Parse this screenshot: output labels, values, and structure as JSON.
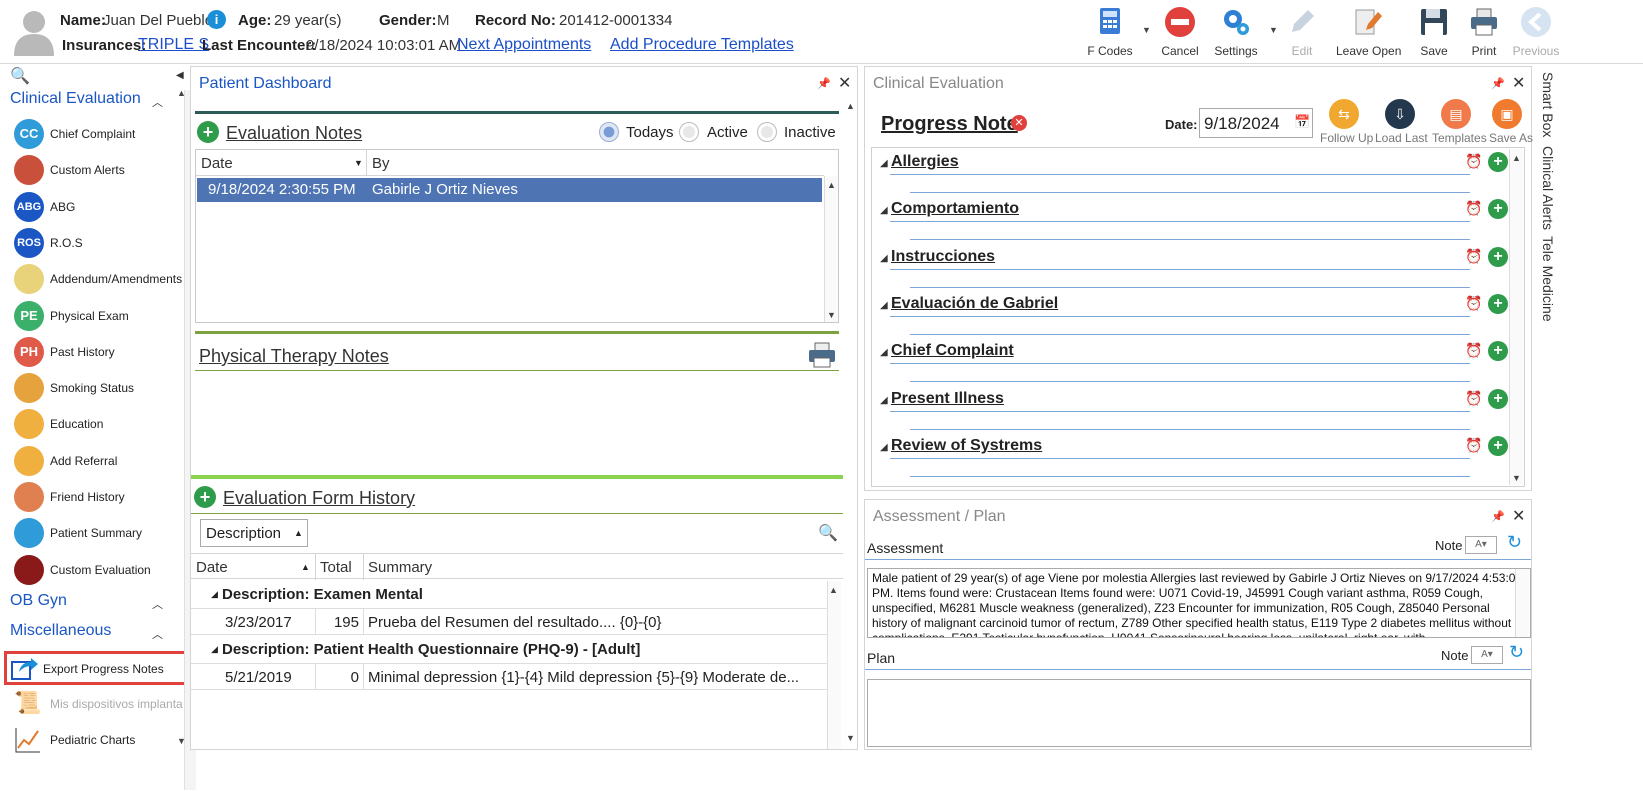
{
  "patient": {
    "name_label": "Name:",
    "name": "Juan Del Pueblo",
    "age_label": "Age:",
    "age": "29 year(s)",
    "gender_label": "Gender:",
    "gender": "M",
    "record_label": "Record No:",
    "record": "201412-0001334",
    "insurances_label": "Insurances:",
    "insurance": "TRIPLE S",
    "last_encounter_label": "Last Encounter:",
    "last_encounter": "9/18/2024 10:03:01 AM",
    "next_appointments": "Next Appointments",
    "add_procedure_templates": "Add Procedure Templates"
  },
  "toolbar": {
    "fcodes": "F Codes",
    "cancel": "Cancel",
    "settings": "Settings",
    "edit": "Edit",
    "leave_open": "Leave Open",
    "save": "Save",
    "print": "Print",
    "previous": "Previous"
  },
  "nav": {
    "clinical_evaluation": "Clinical Evaluation",
    "items": [
      {
        "label": "Chief Complaint",
        "icon": "CC"
      },
      {
        "label": "Custom Alerts",
        "icon": ""
      },
      {
        "label": "ABG",
        "icon": "ABG"
      },
      {
        "label": "R.O.S",
        "icon": "ROS"
      },
      {
        "label": "Addendum/Amendments",
        "icon": ""
      },
      {
        "label": "Physical Exam",
        "icon": "PE"
      },
      {
        "label": "Past History",
        "icon": "PH"
      },
      {
        "label": "Smoking Status",
        "icon": ""
      },
      {
        "label": "Education",
        "icon": ""
      },
      {
        "label": "Add Referral",
        "icon": ""
      },
      {
        "label": "Friend History",
        "icon": ""
      },
      {
        "label": "Patient Summary",
        "icon": ""
      },
      {
        "label": "Custom Evaluation",
        "icon": ""
      }
    ],
    "ob_gyn": "OB Gyn",
    "miscellaneous": "Miscellaneous",
    "misc_items": [
      {
        "label": "Export Progress Notes"
      },
      {
        "label": "Mis dispositivos implanta"
      },
      {
        "label": "Pediatric Charts"
      }
    ]
  },
  "dashboard": {
    "title": "Patient Dashboard",
    "evaluation_notes": "Evaluation Notes",
    "filters": {
      "todays": "Todays",
      "active": "Active",
      "inactive": "Inactive"
    },
    "grid_headers": {
      "date": "Date",
      "by": "By"
    },
    "rows": [
      {
        "date": "9/18/2024 2:30:55 PM",
        "by": "Gabirle J Ortiz Nieves"
      }
    ],
    "physical_therapy_notes": "Physical Therapy Notes",
    "evaluation_form_history": "Evaluation Form History",
    "history_dropdown": "Description",
    "history_headers": {
      "date": "Date",
      "total": "Total",
      "summary": "Summary"
    },
    "groups": [
      {
        "title": "Description: Examen Mental",
        "date": "3/23/2017",
        "total": "195",
        "summary": "Prueba del Resumen del resultado.... {0}-{0}"
      },
      {
        "title": "Description: Patient Health Questionnaire (PHQ-9) - [Adult]",
        "date": "5/21/2019",
        "total": "0",
        "summary": "Minimal depression {1}-{4}  Mild depression {5}-{9}  Moderate de..."
      }
    ]
  },
  "clinical": {
    "title": "Clinical Evaluation",
    "progress_note": "Progress Note",
    "date_label": "Date:",
    "date_value": "9/18/2024",
    "actions": {
      "follow_up": "Follow Up",
      "load_last": "Load Last",
      "templates": "Templates",
      "save_as": "Save As"
    },
    "sections": [
      "Allergies",
      "Comportamiento",
      "Instrucciones",
      "Evaluación de Gabriel",
      "Chief Complaint",
      "Present Illness",
      "Review of Systrems"
    ]
  },
  "assessment": {
    "title": "Assessment / Plan",
    "assessment_label": "Assessment",
    "note_label": "Note",
    "assessment_text": "Male patient of 29 year(s) of age Viene por molestia     Allergies last reviewed by Gabirle J Ortiz Nieves on 9/17/2024 4:53:02 PM.    Items found were:  Crustacean  Items found were:  U071 Covid-19, J45991 Cough variant asthma, R059 Cough, unspecified, M6281 Muscle weakness (generalized), Z23 Encounter for immunization, R05 Cough, Z85040 Personal history of malignant carcinoid tumor of rectum, Z789 Other specified health status, E119 Type 2 diabetes mellitus without complications, E291 Testicular hypofunction, H9041 Sensorineural hearing loss, unilateral, right ear, with",
    "plan_label": "Plan",
    "plan_note_label": "Note"
  },
  "side_tabs": [
    "Smart Box",
    "Clinical Alerts",
    "Tele Medicine"
  ],
  "colors": {
    "accent": "#1a56c4",
    "selected_row": "#4e74b3",
    "add_green": "#2e9c4a",
    "highlight_red": "#e0413d"
  }
}
